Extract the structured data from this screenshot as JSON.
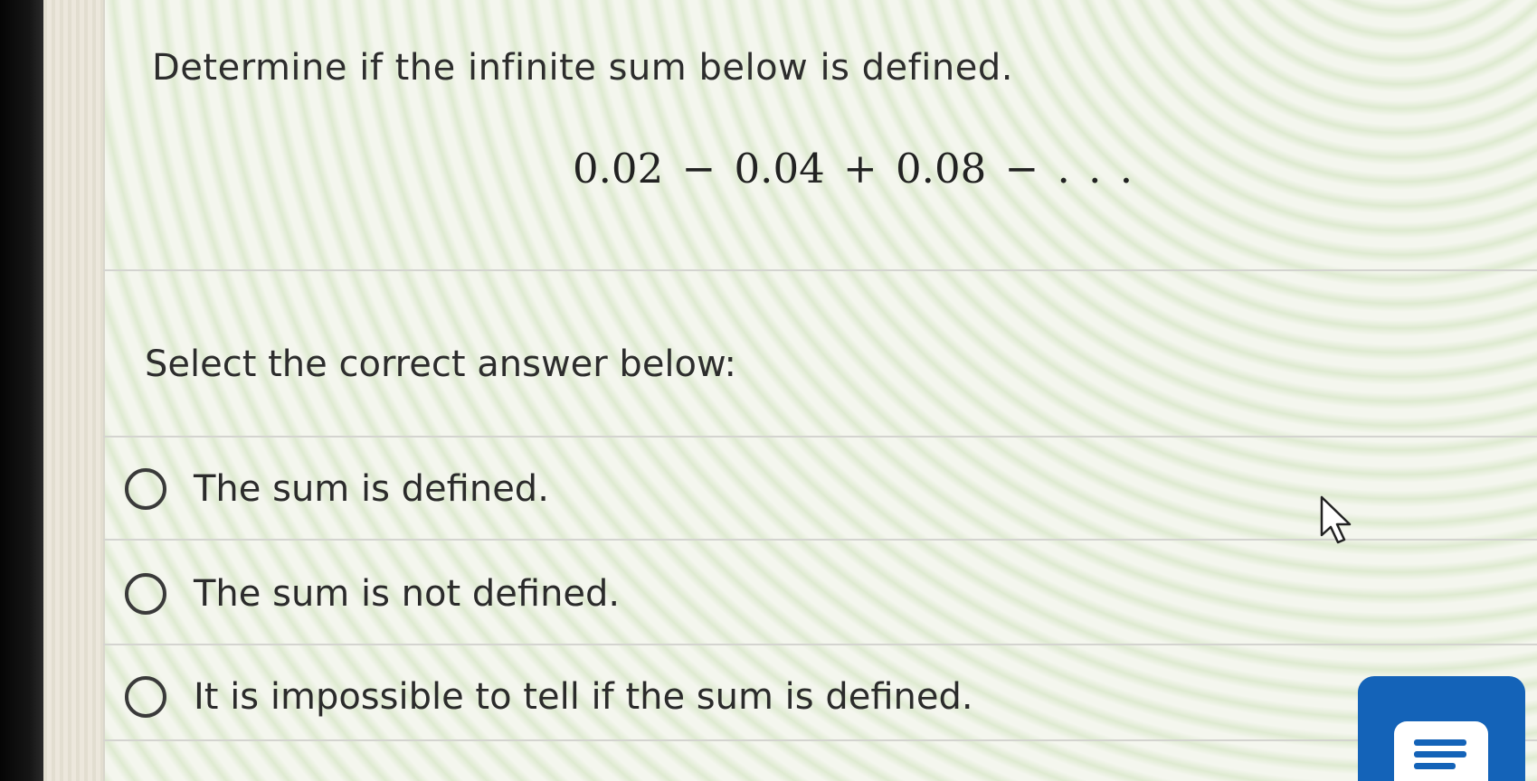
{
  "question": {
    "title": "Determine if the infinite sum below is defined.",
    "expression": "0.02 − 0.04 + 0.08 − . . ."
  },
  "answer_section": {
    "prompt": "Select the correct answer below:",
    "options": [
      {
        "label": "The sum is defined.",
        "selected": false
      },
      {
        "label": "The sum is not defined.",
        "selected": false
      },
      {
        "label": "It is impossible to tell if the sum is defined.",
        "selected": false
      }
    ]
  },
  "icons": {
    "cursor": "mouse-pointer-icon",
    "chat": "chat-icon"
  },
  "colors": {
    "chat_button": "#1463b8",
    "text": "#2d2d2d",
    "radio_border": "#3a3a3a"
  }
}
